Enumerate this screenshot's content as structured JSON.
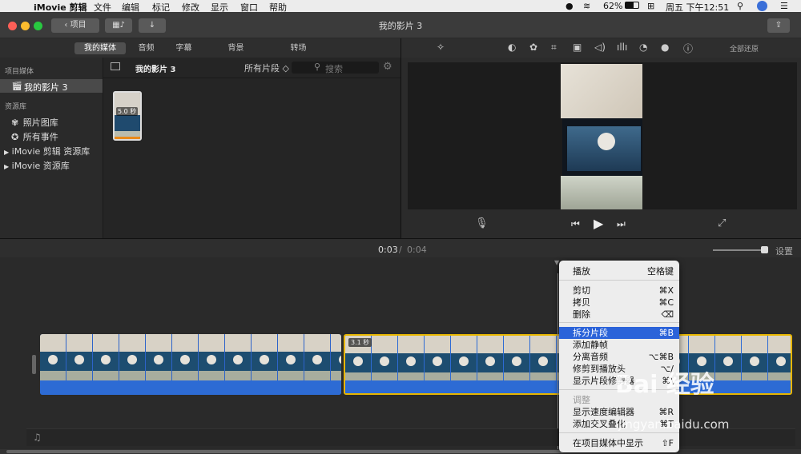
{
  "menubar": {
    "app_name": "iMovie 剪辑",
    "items": [
      "文件",
      "编辑",
      "标记",
      "修改",
      "显示",
      "窗口",
      "帮助"
    ],
    "battery": "62%",
    "datetime": "周五 下午12:51"
  },
  "titlebar": {
    "back_label": "项目",
    "title": "我的影片 3"
  },
  "tabs": [
    "我的媒体",
    "音频",
    "字幕",
    "背景",
    "转场"
  ],
  "viewer_toolbar": {
    "reset_label": "全部还原"
  },
  "sidebar": {
    "section1": "项目媒体",
    "project": "我的影片 3",
    "section2": "资源库",
    "items": [
      "照片图库",
      "所有事件",
      "iMovie 剪辑 资源库",
      "iMovie 资源库"
    ]
  },
  "browser": {
    "title": "我的影片 3",
    "filter": "所有片段 ◇",
    "search_placeholder": "搜索",
    "thumb_duration": "5.0 秒"
  },
  "timebar": {
    "current": "0:03",
    "total": "0:04",
    "settings": "设置"
  },
  "timeline": {
    "clip2_duration": "3.1 秒"
  },
  "context_menu": {
    "items": [
      {
        "label": "播放",
        "shortcut": "空格键"
      },
      {
        "label": "剪切",
        "shortcut": "⌘X"
      },
      {
        "label": "拷贝",
        "shortcut": "⌘C"
      },
      {
        "label": "删除",
        "shortcut": "⌫"
      },
      {
        "label": "拆分片段",
        "shortcut": "⌘B"
      },
      {
        "label": "添加静帧",
        "shortcut": ""
      },
      {
        "label": "分离音频",
        "shortcut": "⌥⌘B"
      },
      {
        "label": "修剪到播放头",
        "shortcut": "⌥/"
      },
      {
        "label": "显示片段修剪器",
        "shortcut": "⌘\\"
      },
      {
        "label": "调整",
        "shortcut": ""
      },
      {
        "label": "显示速度编辑器",
        "shortcut": "⌘R"
      },
      {
        "label": "添加交叉叠化",
        "shortcut": "⌘T"
      },
      {
        "label": "在项目媒体中显示",
        "shortcut": "⇧F"
      }
    ]
  },
  "watermark": {
    "brand": "Bai 经验",
    "url": "jingyan.baidu.com"
  },
  "colors": {
    "selection_blue": "#2b63d9",
    "clip_yellow": "#e8b600",
    "audio_blue": "#2d6bd4"
  }
}
